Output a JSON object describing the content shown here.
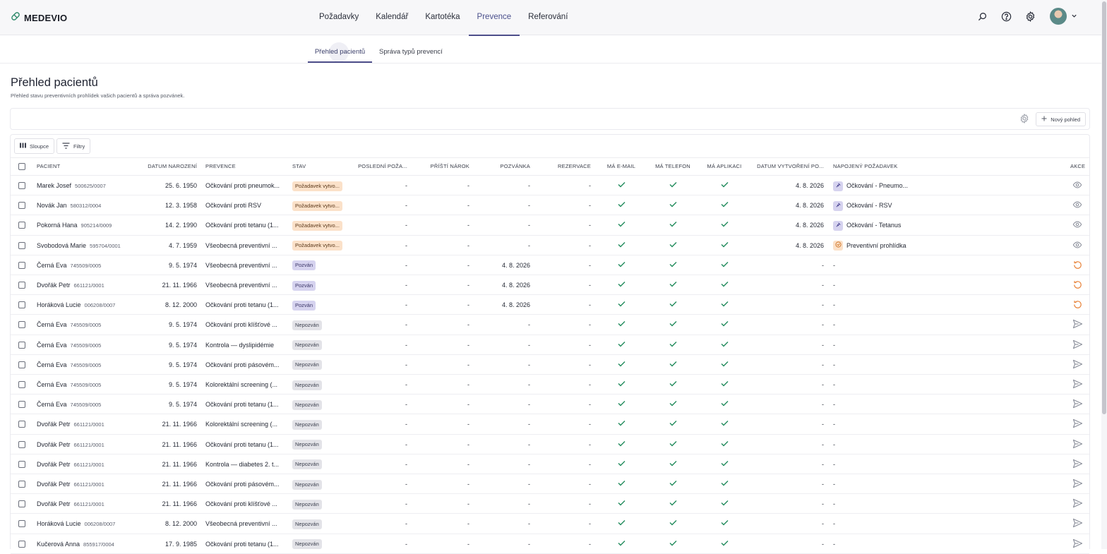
{
  "app": {
    "logo_text": "MEDEVIO"
  },
  "nav": {
    "items": [
      {
        "label": "Požadavky",
        "active": false
      },
      {
        "label": "Kalendář",
        "active": false
      },
      {
        "label": "Kartotéka",
        "active": false
      },
      {
        "label": "Prevence",
        "active": true
      },
      {
        "label": "Referování",
        "active": false
      }
    ]
  },
  "subnav": {
    "tabs": [
      {
        "label": "Přehled pacientů",
        "active": true
      },
      {
        "label": "Správa typů prevencí",
        "active": false
      }
    ]
  },
  "page": {
    "title": "Přehled pacientů",
    "subtitle": "Přehled stavu preventivních prohlídek vašich pacientů a správa pozvánek."
  },
  "views": {
    "new_view_label": "Nový pohled"
  },
  "toolbar": {
    "columns_label": "Sloupce",
    "filters_label": "Filtry"
  },
  "table": {
    "headers": {
      "patient": "PACIENT",
      "dob": "DATUM NAROZENÍ",
      "prevention": "PREVENCE",
      "status": "STAV",
      "last_request": "POSLEDNÍ POŽA...",
      "next_claim": "PŘÍŠTÍ NÁROK",
      "invitation": "POZVÁNKA",
      "reservation": "REZERVACE",
      "has_email": "MÁ E-MAIL",
      "has_phone": "MÁ TELEFON",
      "has_app": "MÁ APLIKACI",
      "created": "DATUM VYTVOŘENÍ PO...",
      "linked": "NAPOJENÝ POŽADAVEK",
      "actions": "AKCE"
    },
    "rows": [
      {
        "name": "Marek Josef",
        "rc": "500625/0007",
        "dob": "25. 6. 1950",
        "prevention": "Očkování proti pneumok...",
        "status": "Požadavek vytvo...",
        "status_color": "orange",
        "last": "-",
        "next": "-",
        "invitation": "-",
        "reservation": "-",
        "created": "4. 8. 2026",
        "linked": "Očkování - Pneumo...",
        "linked_icon": "purple",
        "action": "eye-icon"
      },
      {
        "name": "Novák Jan",
        "rc": "580312/0004",
        "dob": "12. 3. 1958",
        "prevention": "Očkování proti RSV",
        "status": "Požadavek vytvo...",
        "status_color": "orange",
        "last": "-",
        "next": "-",
        "invitation": "-",
        "reservation": "-",
        "created": "4. 8. 2026",
        "linked": "Očkování - RSV",
        "linked_icon": "purple",
        "action": "eye-icon"
      },
      {
        "name": "Pokorná Hana",
        "rc": "905214/0009",
        "dob": "14. 2. 1990",
        "prevention": "Očkování proti tetanu (1...",
        "status": "Požadavek vytvo...",
        "status_color": "orange",
        "last": "-",
        "next": "-",
        "invitation": "-",
        "reservation": "-",
        "created": "4. 8. 2026",
        "linked": "Očkování - Tetanus",
        "linked_icon": "purple",
        "action": "eye-icon"
      },
      {
        "name": "Svobodová Marie",
        "rc": "595704/0001",
        "dob": "4. 7. 1959",
        "prevention": "Všeobecná preventivní ...",
        "status": "Požadavek vytvo...",
        "status_color": "orange",
        "last": "-",
        "next": "-",
        "invitation": "-",
        "reservation": "-",
        "created": "4. 8. 2026",
        "linked": "Preventivní prohlídka",
        "linked_icon": "orange",
        "action": "eye-icon"
      },
      {
        "name": "Černá Eva",
        "rc": "745509/0005",
        "dob": "9. 5. 1974",
        "prevention": "Všeobecná preventivní ...",
        "status": "Pozván",
        "status_color": "purple",
        "last": "-",
        "next": "-",
        "invitation": "4. 8. 2026",
        "reservation": "-",
        "created": "-",
        "linked": "-",
        "linked_icon": "",
        "action": "resend-icon"
      },
      {
        "name": "Dvořák Petr",
        "rc": "661121/0001",
        "dob": "21. 11. 1966",
        "prevention": "Všeobecná preventivní ...",
        "status": "Pozván",
        "status_color": "purple",
        "last": "-",
        "next": "-",
        "invitation": "4. 8. 2026",
        "reservation": "-",
        "created": "-",
        "linked": "-",
        "linked_icon": "",
        "action": "resend-icon"
      },
      {
        "name": "Horáková Lucie",
        "rc": "006208/0007",
        "dob": "8. 12. 2000",
        "prevention": "Očkování proti tetanu (1...",
        "status": "Pozván",
        "status_color": "purple",
        "last": "-",
        "next": "-",
        "invitation": "4. 8. 2026",
        "reservation": "-",
        "created": "-",
        "linked": "-",
        "linked_icon": "",
        "action": "resend-icon"
      },
      {
        "name": "Černá Eva",
        "rc": "745509/0005",
        "dob": "9. 5. 1974",
        "prevention": "Očkování proti klíšťové ...",
        "status": "Nepozván",
        "status_color": "gray",
        "last": "-",
        "next": "-",
        "invitation": "-",
        "reservation": "-",
        "created": "-",
        "linked": "-",
        "linked_icon": "",
        "action": "send-icon"
      },
      {
        "name": "Černá Eva",
        "rc": "745509/0005",
        "dob": "9. 5. 1974",
        "prevention": "Kontrola — dyslipidémie",
        "status": "Nepozván",
        "status_color": "gray",
        "last": "-",
        "next": "-",
        "invitation": "-",
        "reservation": "-",
        "created": "-",
        "linked": "-",
        "linked_icon": "",
        "action": "send-icon"
      },
      {
        "name": "Černá Eva",
        "rc": "745509/0005",
        "dob": "9. 5. 1974",
        "prevention": "Očkování proti pásovém...",
        "status": "Nepozván",
        "status_color": "gray",
        "last": "-",
        "next": "-",
        "invitation": "-",
        "reservation": "-",
        "created": "-",
        "linked": "-",
        "linked_icon": "",
        "action": "send-icon"
      },
      {
        "name": "Černá Eva",
        "rc": "745509/0005",
        "dob": "9. 5. 1974",
        "prevention": "Kolorektální screening (...",
        "status": "Nepozván",
        "status_color": "gray",
        "last": "-",
        "next": "-",
        "invitation": "-",
        "reservation": "-",
        "created": "-",
        "linked": "-",
        "linked_icon": "",
        "action": "send-icon"
      },
      {
        "name": "Černá Eva",
        "rc": "745509/0005",
        "dob": "9. 5. 1974",
        "prevention": "Očkování proti tetanu (1...",
        "status": "Nepozván",
        "status_color": "gray",
        "last": "-",
        "next": "-",
        "invitation": "-",
        "reservation": "-",
        "created": "-",
        "linked": "-",
        "linked_icon": "",
        "action": "send-icon"
      },
      {
        "name": "Dvořák Petr",
        "rc": "661121/0001",
        "dob": "21. 11. 1966",
        "prevention": "Kolorektální screening (...",
        "status": "Nepozván",
        "status_color": "gray",
        "last": "-",
        "next": "-",
        "invitation": "-",
        "reservation": "-",
        "created": "-",
        "linked": "-",
        "linked_icon": "",
        "action": "send-icon"
      },
      {
        "name": "Dvořák Petr",
        "rc": "661121/0001",
        "dob": "21. 11. 1966",
        "prevention": "Očkování proti tetanu (1...",
        "status": "Nepozván",
        "status_color": "gray",
        "last": "-",
        "next": "-",
        "invitation": "-",
        "reservation": "-",
        "created": "-",
        "linked": "-",
        "linked_icon": "",
        "action": "send-icon"
      },
      {
        "name": "Dvořák Petr",
        "rc": "661121/0001",
        "dob": "21. 11. 1966",
        "prevention": "Kontrola — diabetes 2. t...",
        "status": "Nepozván",
        "status_color": "gray",
        "last": "-",
        "next": "-",
        "invitation": "-",
        "reservation": "-",
        "created": "-",
        "linked": "-",
        "linked_icon": "",
        "action": "send-icon"
      },
      {
        "name": "Dvořák Petr",
        "rc": "661121/0001",
        "dob": "21. 11. 1966",
        "prevention": "Očkování proti pásovém...",
        "status": "Nepozván",
        "status_color": "gray",
        "last": "-",
        "next": "-",
        "invitation": "-",
        "reservation": "-",
        "created": "-",
        "linked": "-",
        "linked_icon": "",
        "action": "send-icon"
      },
      {
        "name": "Dvořák Petr",
        "rc": "661121/0001",
        "dob": "21. 11. 1966",
        "prevention": "Očkování proti klíšťové ...",
        "status": "Nepozván",
        "status_color": "gray",
        "last": "-",
        "next": "-",
        "invitation": "-",
        "reservation": "-",
        "created": "-",
        "linked": "-",
        "linked_icon": "",
        "action": "send-icon"
      },
      {
        "name": "Horáková Lucie",
        "rc": "006208/0007",
        "dob": "8. 12. 2000",
        "prevention": "Všeobecná preventivní ...",
        "status": "Nepozván",
        "status_color": "gray",
        "last": "-",
        "next": "-",
        "invitation": "-",
        "reservation": "-",
        "created": "-",
        "linked": "-",
        "linked_icon": "",
        "action": "send-icon"
      },
      {
        "name": "Kučerová Anna",
        "rc": "855917/0004",
        "dob": "17. 9. 1985",
        "prevention": "Očkování proti tetanu (1...",
        "status": "Nepozván",
        "status_color": "gray",
        "last": "-",
        "next": "-",
        "invitation": "-",
        "reservation": "-",
        "created": "-",
        "linked": "-",
        "linked_icon": "",
        "action": "send-icon"
      }
    ]
  },
  "colors": {
    "accent": "#4d4e8a",
    "check": "#1f8a5b",
    "orange_action": "#e8833a"
  }
}
